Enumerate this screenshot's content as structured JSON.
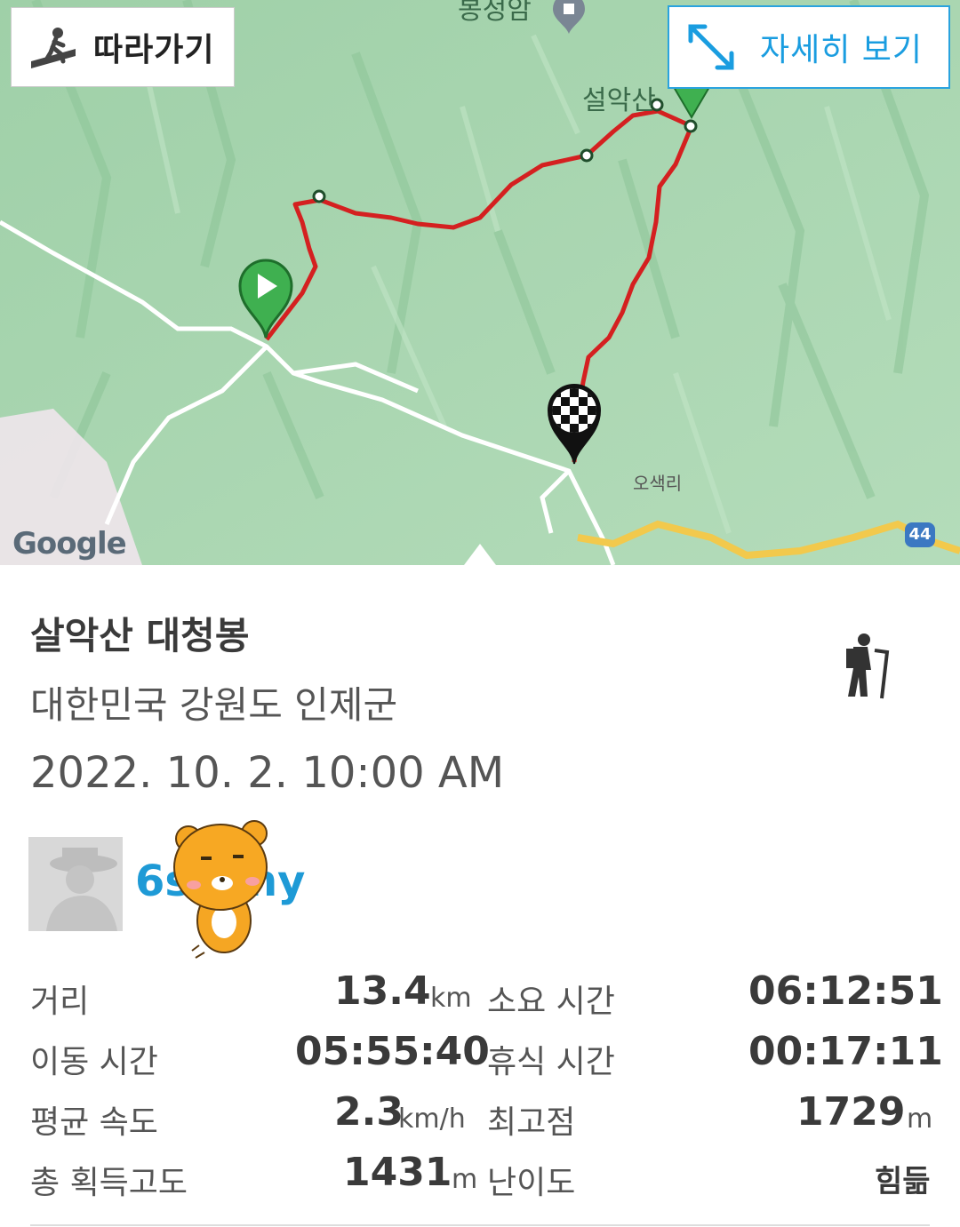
{
  "map": {
    "follow_label": "따라가기",
    "detail_label": "자세히 보기",
    "peak_label": "설악산",
    "top_label": "봉정암",
    "village_label": "오색리",
    "google_label": "Google",
    "route_number": "44"
  },
  "trail": {
    "title": "살악산 대청봉",
    "location": "대한민국 강원도 인제군",
    "datetime": "2022. 10. 2. 10:00 AM",
    "activity_icon": "hiker-icon",
    "username": "6s",
    "username_suffix": "ny"
  },
  "stats": {
    "distance_label": "거리",
    "distance_value": "13.4",
    "distance_unit": "km",
    "total_time_label": "소요 시간",
    "total_time_value": "06:12:51",
    "moving_time_label": "이동 시간",
    "moving_time_value": "05:55:40",
    "rest_time_label": "휴식 시간",
    "rest_time_value": "00:17:11",
    "avg_speed_label": "평균 속도",
    "avg_speed_value": "2.3",
    "avg_speed_unit": "km/h",
    "max_elev_label": "최고점",
    "max_elev_value": "1729",
    "max_elev_unit": "m",
    "elev_gain_label": "총 획득고도",
    "elev_gain_value": "1431",
    "elev_gain_unit": "m",
    "difficulty_label": "난이도",
    "difficulty_value": "힘듦"
  },
  "colors": {
    "route": "#d42020",
    "accent": "#1e9ad6",
    "map_bg": "#a9d7b2"
  }
}
